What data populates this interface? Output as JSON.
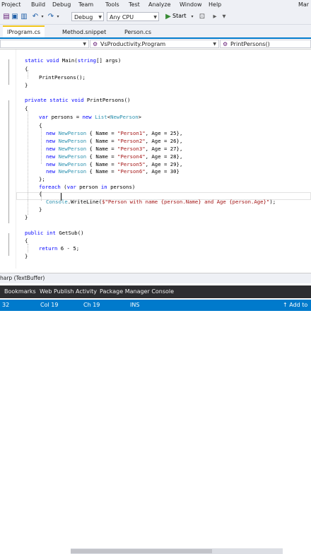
{
  "menu": [
    "Project",
    "Build",
    "Debug",
    "Team",
    "Tools",
    "Test",
    "Analyze",
    "Window",
    "Help",
    "Mar"
  ],
  "toolbar": {
    "config": "Debug",
    "platform": "Any CPU",
    "start_label": "Start"
  },
  "tabs": [
    "lProgram.cs",
    "Method.snippet",
    "Person.cs"
  ],
  "nav": {
    "project": "",
    "class": "VsProductivity.Program",
    "member": "PrintPersons()"
  },
  "code_lines": [
    "static void Main(string[] args)",
    "{",
    "PrintPersons();",
    "}",
    "",
    "private static void PrintPersons()",
    "{",
    "var persons = new List<NewPerson>",
    "{",
    "new NewPerson { Name = \"Person1\", Age = 25},",
    "new NewPerson { Name = \"Person2\", Age = 26},",
    "new NewPerson { Name = \"Person3\", Age = 27},",
    "new NewPerson { Name = \"Person4\", Age = 28},",
    "new NewPerson { Name = \"Person5\", Age = 29},",
    "new NewPerson { Name = \"Person6\", Age = 30}",
    "};",
    "foreach (var person in persons)",
    "{",
    "Console.WriteLine($\"Person with name {person.Name} and Age {person.Age}\");",
    "}",
    "}",
    "",
    "public int GetSub()",
    "{",
    "return 6 - 5;",
    "}"
  ],
  "bottombar": {
    "buffer": "harp (TextBuffer)"
  },
  "tool_windows": [
    "Bookmarks",
    "Web Publish Activity",
    "Package Manager Console"
  ],
  "status": {
    "left": "32",
    "col": "Col 19",
    "ch": "Ch 19",
    "mode": "INS",
    "right": "↑ Add to"
  },
  "colors": {
    "accent": "#007acc",
    "keyword": "#0000ff",
    "type": "#2b91af",
    "string": "#a31515"
  }
}
